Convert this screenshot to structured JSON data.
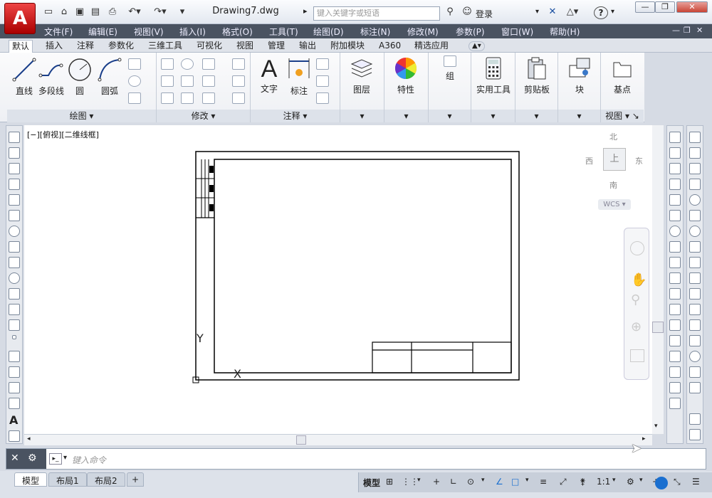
{
  "window": {
    "doc_title": "Drawing7.dwg",
    "search_placeholder": "键入关键字或短语",
    "login": "登录",
    "help": "?"
  },
  "app_logo": "A",
  "menus": [
    "文件(F)",
    "编辑(E)",
    "视图(V)",
    "插入(I)",
    "格式(O)",
    "工具(T)",
    "绘图(D)",
    "标注(N)",
    "修改(M)",
    "参数(P)",
    "窗口(W)",
    "帮助(H)"
  ],
  "ribbon_tabs": [
    "默认",
    "插入",
    "注释",
    "参数化",
    "三维工具",
    "可视化",
    "视图",
    "管理",
    "输出",
    "附加模块",
    "A360",
    "精选应用"
  ],
  "ribbon_panels": {
    "draw": {
      "title": "绘图",
      "tools": [
        "直线",
        "多段线",
        "圆",
        "圆弧"
      ]
    },
    "modify": {
      "title": "修改"
    },
    "annotation": {
      "title": "注释",
      "tools": [
        "文字",
        "标注"
      ]
    },
    "layers": {
      "label": "图层"
    },
    "properties": {
      "label": "特性"
    },
    "groups": {
      "label": "组"
    },
    "utilities": {
      "label": "实用工具"
    },
    "clipboard": {
      "label": "剪贴板"
    },
    "block": {
      "label": "块"
    },
    "view": {
      "title": "视图",
      "label": "基点"
    }
  },
  "viewport_label": "[−][俯视][二维线框]",
  "viewcube": {
    "north": "北",
    "south": "南",
    "east": "东",
    "west": "西",
    "top": "上",
    "wcs": "WCS"
  },
  "ucs": {
    "y": "Y",
    "x": "X"
  },
  "command": {
    "placeholder": "键入命令"
  },
  "layout_tabs": [
    "模型",
    "布局1",
    "布局2",
    "+"
  ],
  "status": {
    "model": "模型",
    "scale": "1:1"
  }
}
